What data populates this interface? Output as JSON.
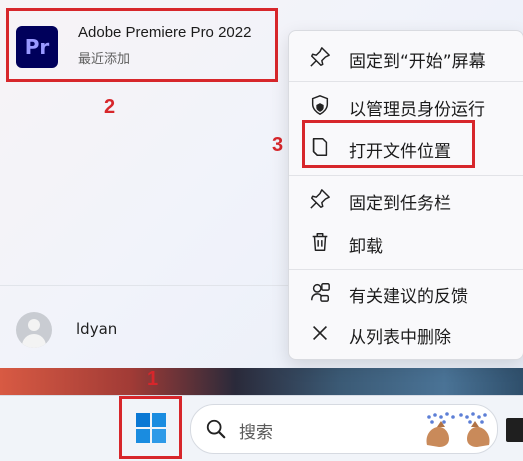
{
  "app": {
    "icon_text": "Pr",
    "title": "Adobe Premiere Pro 2022",
    "subtitle": "最近添加"
  },
  "steps": {
    "one": "1",
    "two": "2",
    "three": "3"
  },
  "user": {
    "name": "ldyan"
  },
  "context_menu": {
    "items": [
      {
        "label": "固定到“开始”屏幕",
        "icon": "pin-icon"
      },
      {
        "label": "以管理员身份运行",
        "icon": "shield-icon"
      },
      {
        "label": "打开文件位置",
        "icon": "file-location-icon"
      },
      {
        "label": "固定到任务栏",
        "icon": "pin-icon"
      },
      {
        "label": "卸载",
        "icon": "trash-icon"
      },
      {
        "label": "有关建议的反馈",
        "icon": "feedback-icon"
      },
      {
        "label": "从列表中删除",
        "icon": "close-icon"
      }
    ]
  },
  "taskbar": {
    "search_placeholder": "搜索"
  },
  "colors": {
    "highlight": "#d7262b",
    "premiere_bg": "#00005b",
    "premiere_fg": "#9999ff",
    "windows_blue": "#0a78d4"
  }
}
